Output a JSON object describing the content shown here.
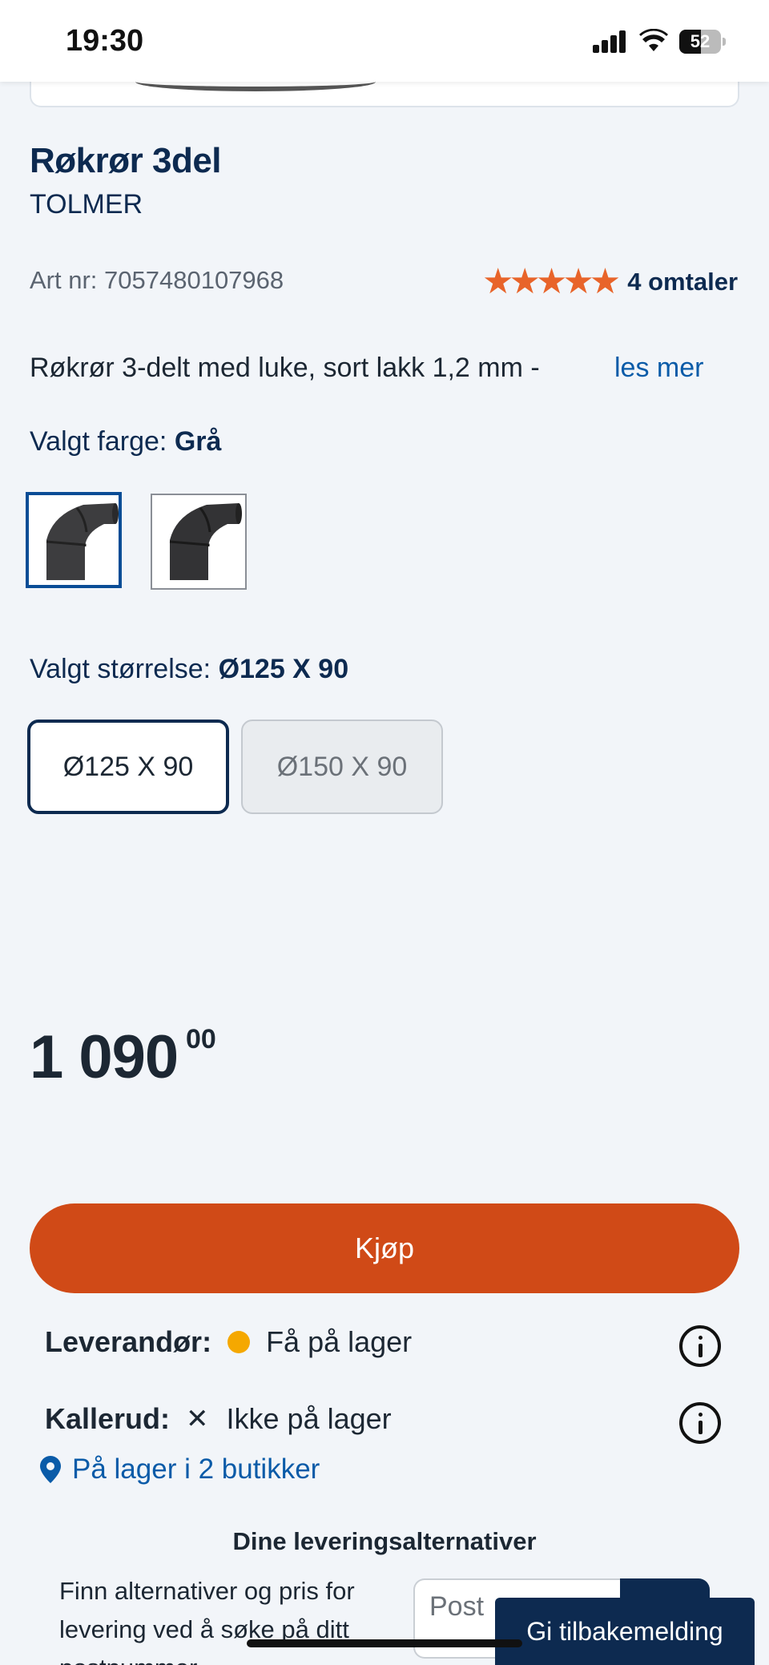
{
  "status_bar": {
    "time": "19:30",
    "battery": "52"
  },
  "product": {
    "title": "Røkrør 3del",
    "brand": "TOLMER",
    "art_nr": "Art nr: 7057480107968",
    "rating_stars": "★★★★★",
    "reviews": "4 omtaler",
    "description": "Røkrør 3-delt med luke, sort lakk 1,2 mm -",
    "read_more": "les mer"
  },
  "color": {
    "label": "Valgt farge:",
    "value": "Grå"
  },
  "size": {
    "label": "Valgt størrelse:",
    "value": "Ø125 X 90",
    "options": [
      {
        "label": "Ø125 X 90",
        "selected": true
      },
      {
        "label": "Ø150 X 90",
        "selected": false
      }
    ]
  },
  "price": {
    "main": "1 090",
    "cents": "00"
  },
  "buy_label": "Kjøp",
  "stock": {
    "supplier_label": "Leverandør:",
    "supplier_status": "Få på lager",
    "store_label": "Kallerud:",
    "store_status": "Ikke på lager",
    "stores_link": "På lager i 2 butikker"
  },
  "delivery": {
    "title": "Dine leveringsalternativer",
    "text": "Finn alternativer og pris for levering ved å søke på ditt postnummer",
    "placeholder": "Post"
  },
  "feedback_label": "Gi tilbakemelding",
  "colors": {
    "accent": "#d04a17",
    "navy": "#0d2a50",
    "link": "#0a5ba8",
    "star": "#e8642a",
    "stock_dot": "#f5a800"
  }
}
